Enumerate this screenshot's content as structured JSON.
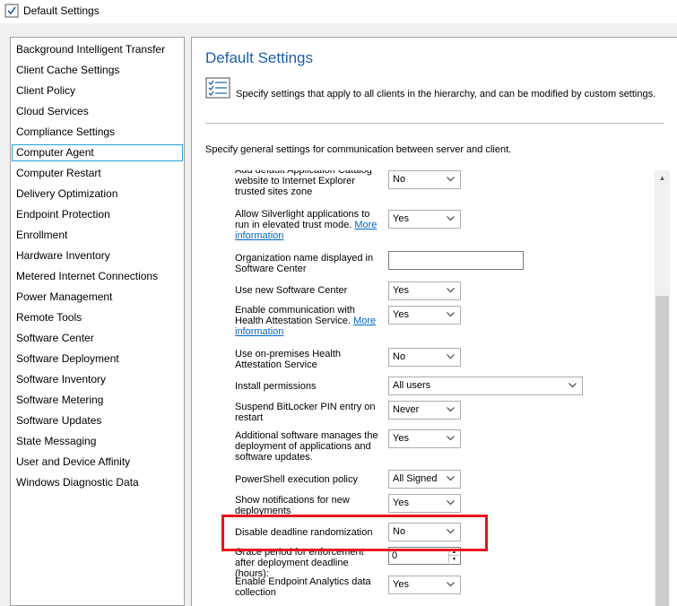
{
  "window": {
    "title": "Default Settings"
  },
  "nav": {
    "items": [
      "Background Intelligent Transfer",
      "Client Cache Settings",
      "Client Policy",
      "Cloud Services",
      "Compliance Settings",
      "Computer Agent",
      "Computer Restart",
      "Delivery Optimization",
      "Endpoint Protection",
      "Enrollment",
      "Hardware Inventory",
      "Metered Internet Connections",
      "Power Management",
      "Remote Tools",
      "Software Center",
      "Software Deployment",
      "Software Inventory",
      "Software Metering",
      "Software Updates",
      "State Messaging",
      "User and Device Affinity",
      "Windows Diagnostic Data"
    ],
    "selected": "Computer Agent"
  },
  "panel": {
    "heading": "Default Settings",
    "description": "Specify settings that apply to all clients in the hierarchy, and can be modified by custom settings.",
    "sub_description": "Specify general settings for communication between server and client."
  },
  "settings": {
    "catalog": {
      "label": "Add default Application Catalog website to Internet Explorer trusted sites zone",
      "value": "No"
    },
    "silverlight": {
      "label": "Allow Silverlight applications to run in elevated trust mode.",
      "link": "More information",
      "value": "Yes"
    },
    "org_name": {
      "label": "Organization name displayed in Software Center",
      "value": ""
    },
    "new_sw_center": {
      "label": "Use new Software Center",
      "value": "Yes"
    },
    "health_attest": {
      "label": "Enable communication with Health Attestation Service.",
      "link": "More information",
      "value": "Yes"
    },
    "onprem_health": {
      "label": "Use on-premises Health Attestation Service",
      "value": "No"
    },
    "install_perm": {
      "label": "Install permissions",
      "value": "All users"
    },
    "bitlocker": {
      "label": "Suspend BitLocker PIN entry on restart",
      "value": "Never"
    },
    "additional_sw": {
      "label": "Additional software manages the deployment of applications and software updates.",
      "value": "Yes"
    },
    "powershell": {
      "label": "PowerShell execution policy",
      "value": "All Signed"
    },
    "notifications": {
      "label": "Show notifications for new deployments",
      "value": "Yes"
    },
    "deadline_random": {
      "label": "Disable deadline randomization",
      "value": "No"
    },
    "grace_period": {
      "label": "Grace period for enforcement after deployment deadline (hours):",
      "value": "0"
    },
    "endpoint_analytics": {
      "label": "Enable Endpoint Analytics data collection",
      "value": "Yes"
    }
  },
  "colors": {
    "heading": "#1c5fae",
    "link": "#0066cc",
    "highlight": "#e8101f",
    "selection_border": "#26a0da"
  }
}
